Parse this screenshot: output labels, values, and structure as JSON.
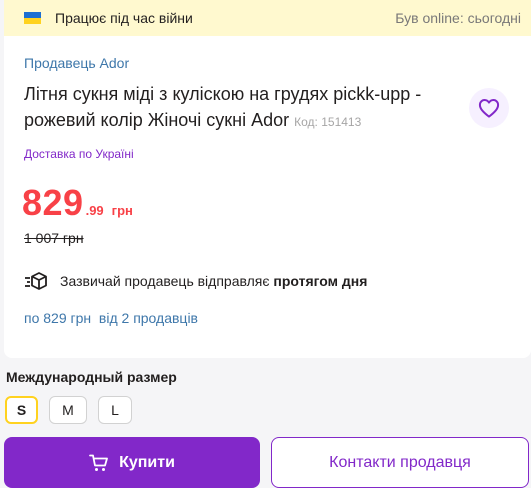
{
  "banner": {
    "left_text": "Працює під час війни",
    "right_text": "Був online: сьогодні",
    "flag_colors": [
      "#1d6fd1",
      "#ffd21f"
    ]
  },
  "product": {
    "seller_link": "Продавець Ador",
    "title": "Літня сукня міді з кулiскою на грудях pickk-upp - рожевий колір Жіночі сукні Ador",
    "code": "Код: 151413",
    "delivery": "Доставка по Україні",
    "price_int": "829",
    "price_cents": ".99",
    "currency": "грн",
    "old_price": "1 007 грн",
    "shipping_prefix": "Зазвичай продавець відправляє",
    "shipping_bold": "протягом дня",
    "offers": "по 829 грн  від 2 продавців"
  },
  "sizes": {
    "label": "Международный размер",
    "options": [
      "S",
      "M",
      "L"
    ],
    "selected": "S"
  },
  "actions": {
    "buy_label": "Купити",
    "contact_label": "Контакти продавця"
  },
  "colors": {
    "accent": "#8228c9",
    "price": "#f84147",
    "link": "#3e77aa",
    "banner_bg": "#fff9cf",
    "selected_border": "#ffd21f"
  },
  "icons": [
    "ukraine-flag-icon",
    "heart-icon",
    "shipping-box-icon",
    "cart-icon"
  ]
}
